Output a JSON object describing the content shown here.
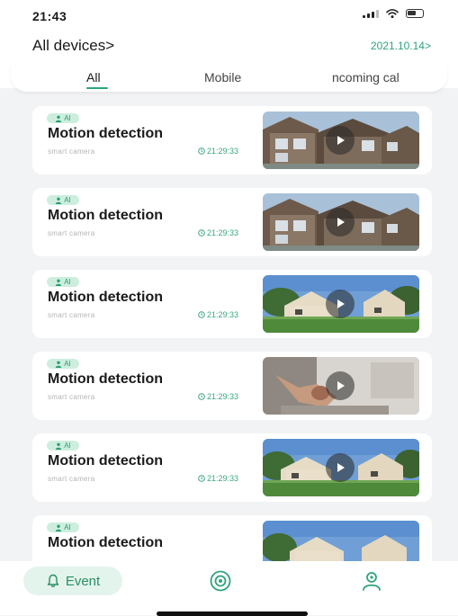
{
  "status_bar": {
    "time": "21:43"
  },
  "header": {
    "title": "All devices",
    "title_chevron": ">",
    "date": "2021.10.14",
    "date_chevron": ">"
  },
  "tabs": [
    {
      "label": "All",
      "active": true
    },
    {
      "label": "Mobile",
      "active": false
    },
    {
      "label": "ncoming cal",
      "active": false
    }
  ],
  "events": [
    {
      "badge": "AI",
      "title": "Motion detection",
      "subtitle": "smart camera",
      "time": "21:29:33",
      "thumb_scene": "house-close"
    },
    {
      "badge": "AI",
      "title": "Motion detection",
      "subtitle": "smart camera",
      "time": "21:29:33",
      "thumb_scene": "house-close"
    },
    {
      "badge": "AI",
      "title": "Motion detection",
      "subtitle": "smart camera",
      "time": "21:29:33",
      "thumb_scene": "house-lawn"
    },
    {
      "badge": "AI",
      "title": "Motion detection",
      "subtitle": "smart camera",
      "time": "21:29:33",
      "thumb_scene": "indoor"
    },
    {
      "badge": "AI",
      "title": "Motion detection",
      "subtitle": "smart camera",
      "time": "21:29:33",
      "thumb_scene": "house-lawn"
    },
    {
      "badge": "AI",
      "title": "Motion detection",
      "subtitle": "smart camera",
      "time": "",
      "thumb_scene": "house-lawn"
    }
  ],
  "bottom_nav": {
    "event_label": "Event",
    "colors": {
      "accent": "#2fa37a",
      "pill_bg": "#e3f4ec"
    }
  }
}
